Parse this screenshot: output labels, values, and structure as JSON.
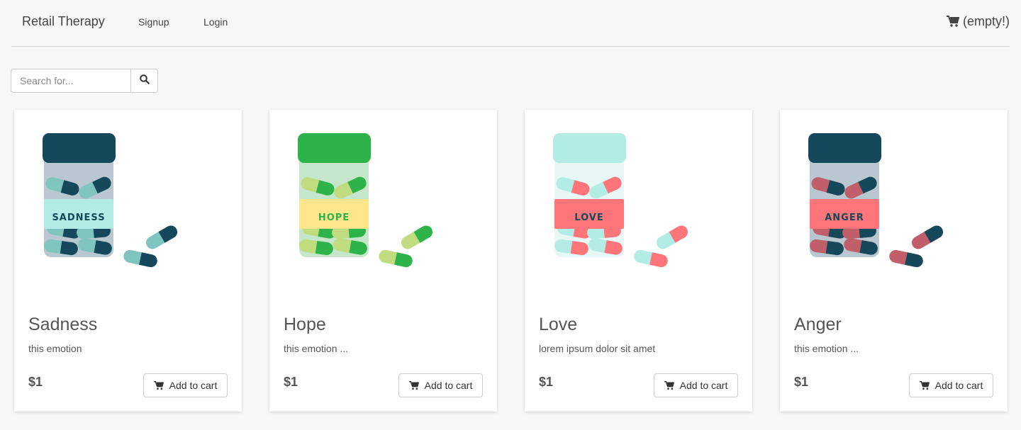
{
  "header": {
    "brand": "Retail Therapy",
    "nav": [
      "Signup",
      "Login"
    ],
    "cart_text": "(empty!)",
    "cart_icon": "cart-icon"
  },
  "search": {
    "placeholder": "Search for...",
    "button_icon": "search-icon"
  },
  "products": [
    {
      "title": "Sadness",
      "description": "this emotion",
      "price": "$1",
      "button_label": "Add to cart",
      "label": "SADNESS",
      "colors": {
        "lid": "#15485a",
        "jar": "#b9c7d0",
        "band": "#b2ece4",
        "pillA": "#15485a",
        "pillB": "#80c4c0",
        "text": "#15485a"
      }
    },
    {
      "title": "Hope",
      "description": "this emotion ...",
      "price": "$1",
      "button_label": "Add to cart",
      "label": "HOPE",
      "colors": {
        "lid": "#2db34a",
        "jar": "#c6e6cc",
        "band": "#fde68c",
        "pillA": "#2db34a",
        "pillB": "#c1dc7e",
        "text": "#2db34a"
      }
    },
    {
      "title": "Love",
      "description": "lorem ipsum dolor sit amet",
      "price": "$1",
      "button_label": "Add to cart",
      "label": "LOVE",
      "colors": {
        "lid": "#b2ece4",
        "jar": "#e6f7f5",
        "band": "#ff757a",
        "pillA": "#ff757a",
        "pillB": "#b2ece4",
        "text": "#15485a"
      }
    },
    {
      "title": "Anger",
      "description": "this emotion ...",
      "price": "$1",
      "button_label": "Add to cart",
      "label": "ANGER",
      "colors": {
        "lid": "#15485a",
        "jar": "#b9c7d0",
        "band": "#ff757a",
        "pillA": "#15485a",
        "pillB": "#c05e6a",
        "text": "#15485a"
      }
    }
  ]
}
